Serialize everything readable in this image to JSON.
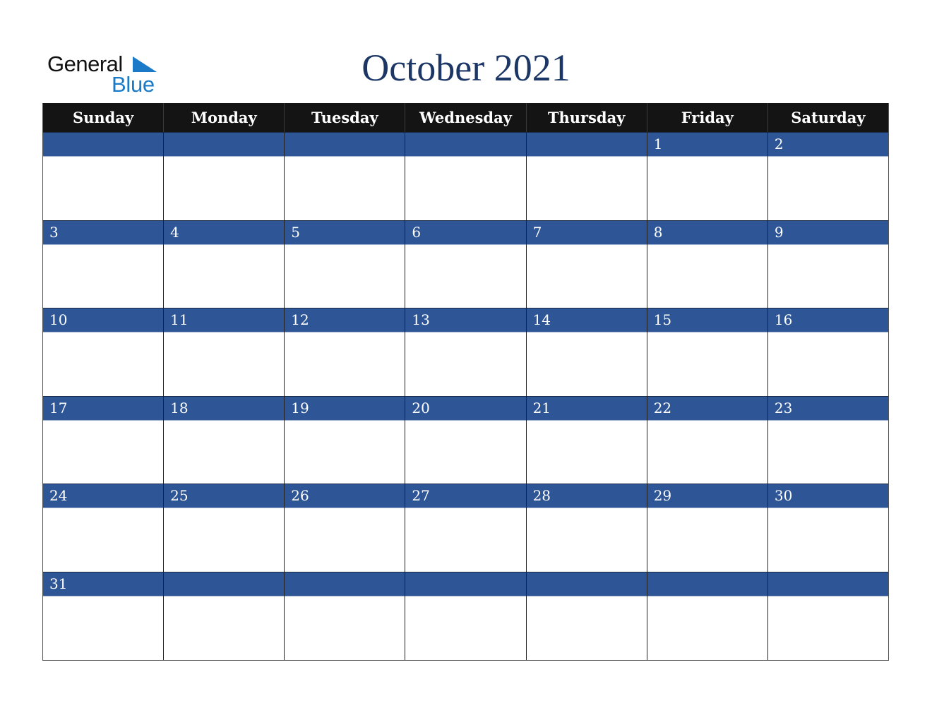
{
  "logo": {
    "line1": "General",
    "line2": "Blue",
    "icon": "triangle-flag-icon",
    "brand_color": "#1a7ac8"
  },
  "title": "October 2021",
  "colors": {
    "title": "#1c3766",
    "header_bg": "#141414",
    "date_band": "#2e5595"
  },
  "weekdays": [
    "Sunday",
    "Monday",
    "Tuesday",
    "Wednesday",
    "Thursday",
    "Friday",
    "Saturday"
  ],
  "weeks": [
    [
      "",
      "",
      "",
      "",
      "",
      "1",
      "2"
    ],
    [
      "3",
      "4",
      "5",
      "6",
      "7",
      "8",
      "9"
    ],
    [
      "10",
      "11",
      "12",
      "13",
      "14",
      "15",
      "16"
    ],
    [
      "17",
      "18",
      "19",
      "20",
      "21",
      "22",
      "23"
    ],
    [
      "24",
      "25",
      "26",
      "27",
      "28",
      "29",
      "30"
    ],
    [
      "31",
      "",
      "",
      "",
      "",
      "",
      ""
    ]
  ]
}
